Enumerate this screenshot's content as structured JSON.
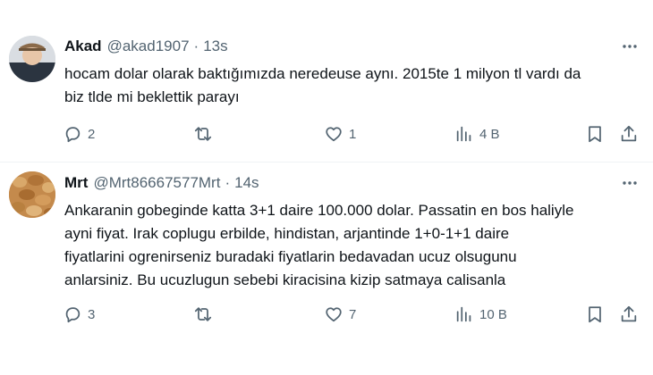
{
  "tweets": [
    {
      "name": "Akad",
      "handle": "@akad1907",
      "separator": "·",
      "time": "13s",
      "text_lines": [
        "hocam dolar olarak baktığımızda neredeuse aynı. 2015te 1 milyon tl vardı da",
        "biz tlde mi beklettik parayı"
      ],
      "replies": "2",
      "retweets": "",
      "likes": "1",
      "views": "4 B",
      "avatar_color": "#cfd4d9"
    },
    {
      "name": "Mrt",
      "handle": "@Mrt86667577Mrt",
      "separator": "·",
      "time": "14s",
      "text_lines": [
        "Ankaranin gobeginde katta 3+1 daire 100.000 dolar. Passatin en bos haliyle",
        "ayni fiyat. Irak coplugu erbilde, hindistan, arjantinde 1+0-1+1 daire",
        "fiyatlarini ogrenirseniz buradaki fiyatlarin bedavadan ucuz olsugunu",
        "anlarsiniz. Bu ucuzlugun sebebi kiracisina kizip satmaya calisanla"
      ],
      "replies": "3",
      "retweets": "",
      "likes": "7",
      "views": "10 B",
      "avatar_color": "#c9945a"
    }
  ],
  "icons": {
    "more": "more-horizontal-icon",
    "reply": "reply-bubble-icon",
    "retweet": "retweet-arrows-icon",
    "like": "heart-icon",
    "views": "bar-chart-icon",
    "bookmark": "bookmark-icon",
    "share": "share-upload-icon"
  },
  "colors": {
    "text_primary": "#0f1419",
    "text_secondary": "#536471",
    "divider": "#eff3f4"
  }
}
